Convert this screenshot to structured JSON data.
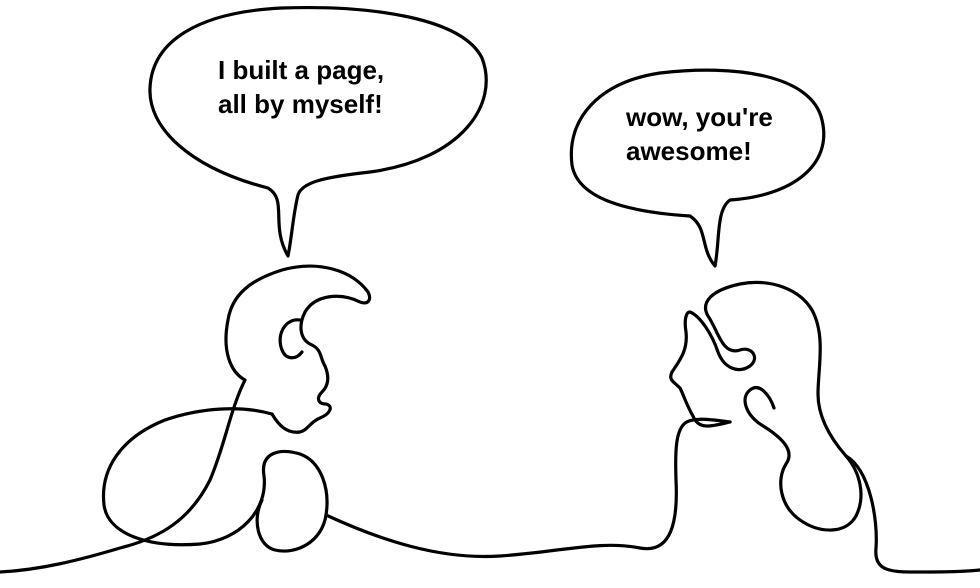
{
  "illustration": {
    "line_color": "#000000",
    "background_color": "#ffffff"
  },
  "speech_left": {
    "line1": "I built a page,",
    "line2": "all by myself!"
  },
  "speech_right": {
    "line1": "wow, you're",
    "line2": "awesome!"
  }
}
